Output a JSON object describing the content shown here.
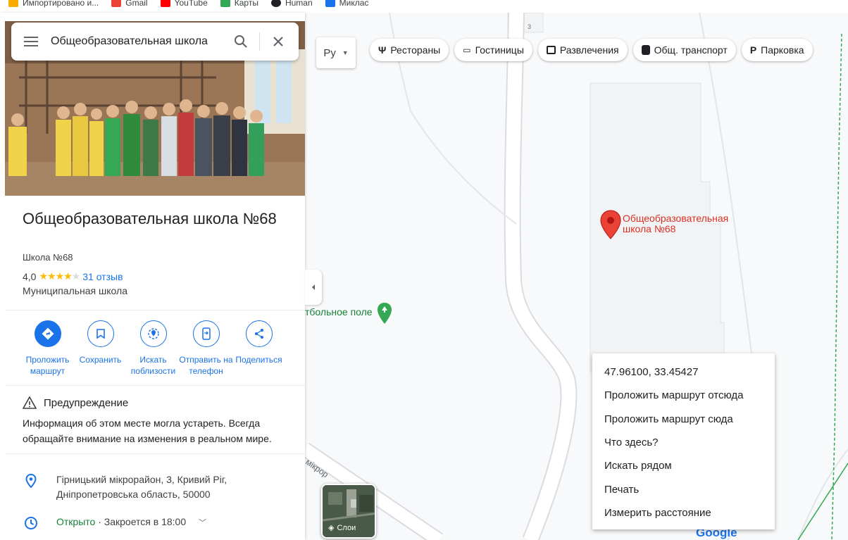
{
  "bookmarks": [
    {
      "label": "Импортировано и...",
      "color": "#f9ab00"
    },
    {
      "label": "Gmail",
      "color": "#ea4335"
    },
    {
      "label": "YouTube",
      "color": "#ff0000"
    },
    {
      "label": "Карты",
      "color": "#34a853"
    },
    {
      "label": "Human",
      "color": "#202124"
    },
    {
      "label": "Миклас",
      "color": "#1a73e8"
    }
  ],
  "search": {
    "value": "Общеобразовательная школа"
  },
  "place": {
    "title": "Общеобразовательная школа №68",
    "subtitle": "Школа №68",
    "rating": "4,0",
    "rating_value": 4.0,
    "reviews": "31 отзыв",
    "category": "Муниципальная школа"
  },
  "actions": [
    {
      "label": "Проложить маршрут",
      "icon": "directions-icon"
    },
    {
      "label": "Сохранить",
      "icon": "bookmark-icon"
    },
    {
      "label": "Искать поблизости",
      "icon": "nearby-icon"
    },
    {
      "label": "Отправить на телефон",
      "icon": "send-to-phone-icon"
    },
    {
      "label": "Поделиться",
      "icon": "share-icon"
    }
  ],
  "warning": {
    "title": "Предупреждение",
    "text": "Информация об этом месте могла устареть. Всегда обращайте внимание на изменения в реальном мире."
  },
  "address": {
    "line1": "Гірницький мікрорайон, 3, Кривий Ріг,",
    "line2": "Дніпропетровська область, 50000"
  },
  "hours": {
    "status": "Открыто",
    "detail": " · Закроется в 18:00"
  },
  "map": {
    "type_select": "Ру",
    "chips": [
      {
        "label": "Рестораны",
        "icon": "restaurant-icon"
      },
      {
        "label": "Гостиницы",
        "icon": "hotel-icon"
      },
      {
        "label": "Развлечения",
        "icon": "camera-icon"
      },
      {
        "label": "Общ. транспорт",
        "icon": "transit-icon"
      },
      {
        "label": "Парковка",
        "icon": "parking-icon"
      }
    ],
    "marker_label": "Общеобразовательная школа №68",
    "field_label": "тбольное поле",
    "street_label": "мікрор",
    "building_number": "3",
    "layers_label": "Слои",
    "google_logo": "Google"
  },
  "context_menu": {
    "coords": "47.96100, 33.45427",
    "items": [
      "Проложить маршрут отсюда",
      "Проложить маршрут сюда",
      "Что здесь?",
      "Искать рядом",
      "Печать",
      "Измерить расстояние"
    ]
  },
  "colors": {
    "accent": "#1a73e8",
    "marker": "#ea4335",
    "open": "#188038",
    "star": "#fbbc04"
  }
}
